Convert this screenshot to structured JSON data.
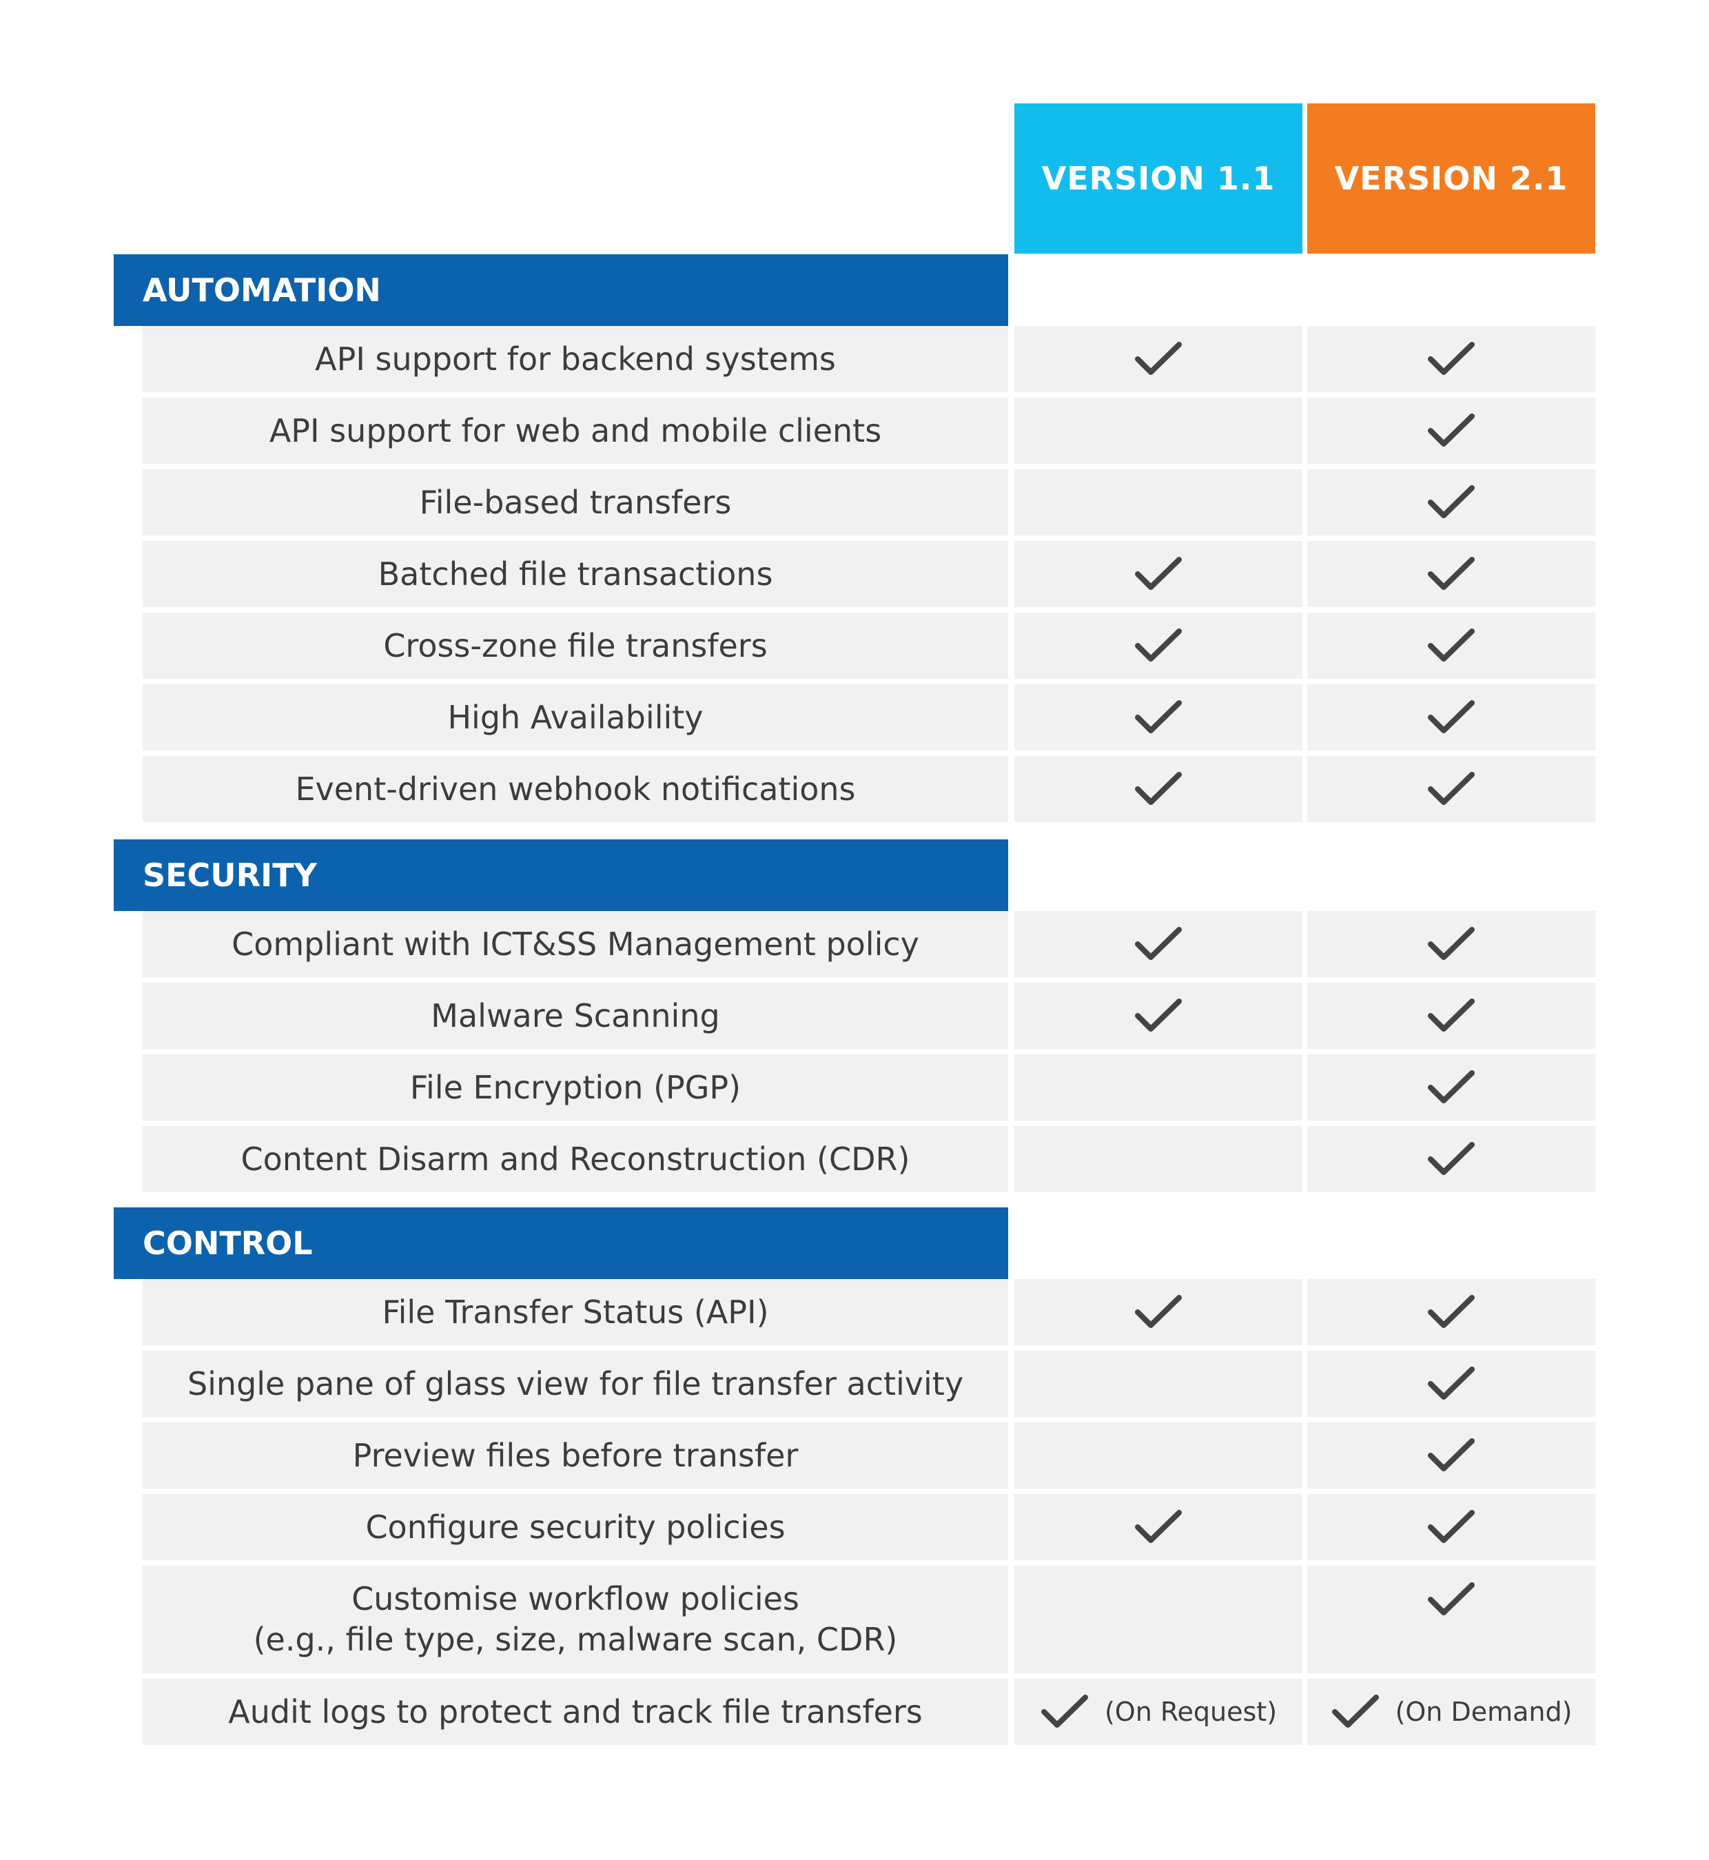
{
  "colors": {
    "version_1_1": "#12bdee",
    "version_2_1": "#f47c20",
    "section": "#0c62ac",
    "row": "#f1f1f1",
    "text": "#3c3c3c",
    "check": "#444444"
  },
  "versions": [
    "VERSION 1.1",
    "VERSION 2.1"
  ],
  "check_icon": "check-icon",
  "sections": [
    {
      "title": "AUTOMATION",
      "rows": [
        {
          "feature": "API support for backend systems",
          "v1": true,
          "v2": true
        },
        {
          "feature": "API support for web and mobile clients",
          "v1": false,
          "v2": true
        },
        {
          "feature": "File-based transfers",
          "v1": false,
          "v2": true
        },
        {
          "feature": "Batched file transactions",
          "v1": true,
          "v2": true
        },
        {
          "feature": "Cross-zone file transfers",
          "v1": true,
          "v2": true
        },
        {
          "feature": "High Availability",
          "v1": true,
          "v2": true
        },
        {
          "feature": "Event-driven webhook notifications",
          "v1": true,
          "v2": true
        }
      ]
    },
    {
      "title": "SECURITY",
      "rows": [
        {
          "feature": "Compliant with ICT&SS Management policy",
          "v1": true,
          "v2": true
        },
        {
          "feature": "Malware Scanning",
          "v1": true,
          "v2": true
        },
        {
          "feature": "File Encryption (PGP)",
          "v1": false,
          "v2": true
        },
        {
          "feature": "Content Disarm and Reconstruction (CDR)",
          "v1": false,
          "v2": true
        }
      ]
    },
    {
      "title": "CONTROL",
      "rows": [
        {
          "feature": "File Transfer Status (API)",
          "v1": true,
          "v2": true
        },
        {
          "feature": "Single pane of glass view for file transfer activity",
          "v1": false,
          "v2": true
        },
        {
          "feature": "Preview files before transfer",
          "v1": false,
          "v2": true
        },
        {
          "feature": "Configure security policies",
          "v1": true,
          "v2": true
        },
        {
          "feature": "Customise workflow policies\n(e.g., file type, size, malware scan, CDR)",
          "v1": false,
          "v2": true
        },
        {
          "feature": "Audit logs to protect and track file transfers",
          "v1": true,
          "v2": true,
          "v1_note": "(On Request)",
          "v2_note": "(On Demand)"
        }
      ]
    }
  ]
}
